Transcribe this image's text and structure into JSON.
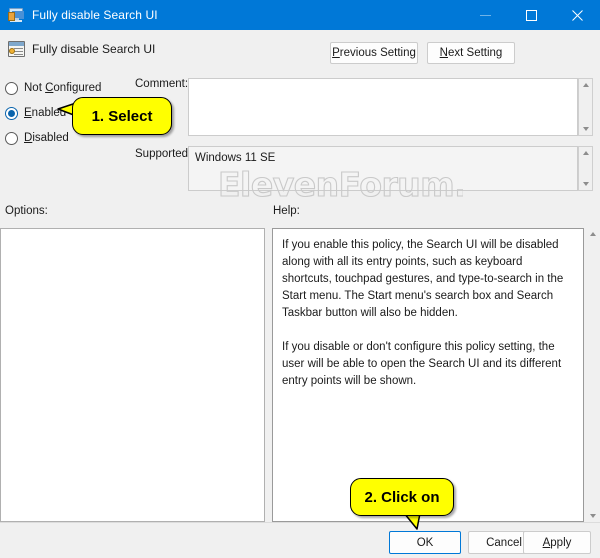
{
  "window": {
    "title": "Fully disable Search UI",
    "title_icon": "monitor-icon",
    "minimize_icon": "minimize-icon",
    "maximize_icon": "maximize-icon",
    "close_icon": "close-icon",
    "accent_color": "#0078d7",
    "background_color": "#f0f0f0"
  },
  "header": {
    "policy_icon": "policy-setting-icon",
    "policy_title": "Fully disable Search UI",
    "previous_setting": "Previous Setting",
    "next_setting": "Next Setting"
  },
  "state_options": {
    "not_configured": "Not Configured",
    "enabled": "Enabled",
    "disabled": "Disabled",
    "selected": "Enabled"
  },
  "fields": {
    "comment_label": "Comment:",
    "comment_value": "",
    "supported_label": "Supported on:",
    "supported_value": "Windows 11 SE",
    "options_label": "Options:",
    "help_label": "Help:"
  },
  "help": {
    "paragraph1": "If you enable this policy, the Search UI will be disabled along with all its entry points, such as keyboard shortcuts, touchpad gestures, and type-to-search in the Start menu. The Start menu's search box and Search Taskbar button will also be hidden.",
    "paragraph2": "If you disable or don't configure this policy setting, the user will be able to open the Search UI and its different entry points will be shown."
  },
  "options_panel": {
    "content": ""
  },
  "buttons": {
    "ok": "OK",
    "cancel": "Cancel",
    "apply": "Apply"
  },
  "callouts": {
    "step1": "1. Select",
    "step2": "2. Click on",
    "color": "#ffff00"
  },
  "watermark": {
    "text": "ElevenForum.com",
    "color": "#c9c9c9"
  },
  "scrollbars": {
    "up_arrow_icon": "caret-up-icon",
    "down_arrow_icon": "caret-down-icon"
  }
}
